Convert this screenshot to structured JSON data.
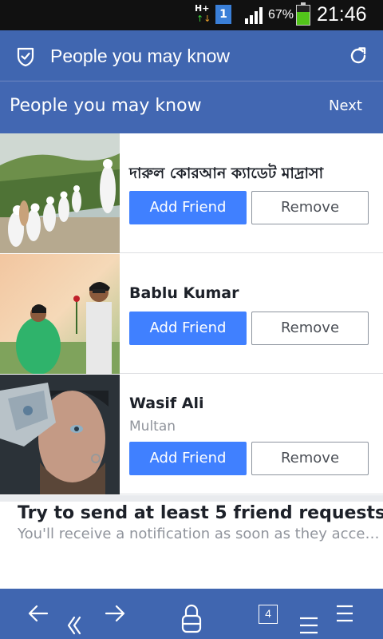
{
  "status_bar": {
    "network": "H+",
    "sim": "1",
    "battery_pct": "67%",
    "battery_level": 0.67,
    "time": "21:46",
    "icons": [
      "network-type-icon",
      "sim-icon",
      "signal-icon",
      "battery-icon"
    ]
  },
  "browser": {
    "title": "People you may know",
    "icons": [
      "shield-icon",
      "refresh-icon"
    ]
  },
  "header": {
    "title": "People you may know",
    "next_label": "Next"
  },
  "people": [
    {
      "name": "দারুল কোরআন ক্যাডেট মাদ্রাসা",
      "location": "",
      "add_label": "Add Friend",
      "remove_label": "Remove"
    },
    {
      "name": "Bablu Kumar",
      "location": "",
      "add_label": "Add Friend",
      "remove_label": "Remove"
    },
    {
      "name": "Wasif Ali",
      "location": "Multan",
      "add_label": "Add Friend",
      "remove_label": "Remove"
    }
  ],
  "info": {
    "title": "Try to send at least 5 friend requests",
    "subtitle": "You'll receive a notification as soon as they accept your request."
  },
  "bottom_nav": {
    "tab_count": "4",
    "icons": [
      "back-arrow-icon",
      "double-chevron-left-icon",
      "forward-arrow-icon",
      "lock-icon",
      "tabs-icon",
      "menu-icon"
    ]
  },
  "colors": {
    "brand_blue": "#4267b2",
    "button_blue": "#4080ff"
  }
}
